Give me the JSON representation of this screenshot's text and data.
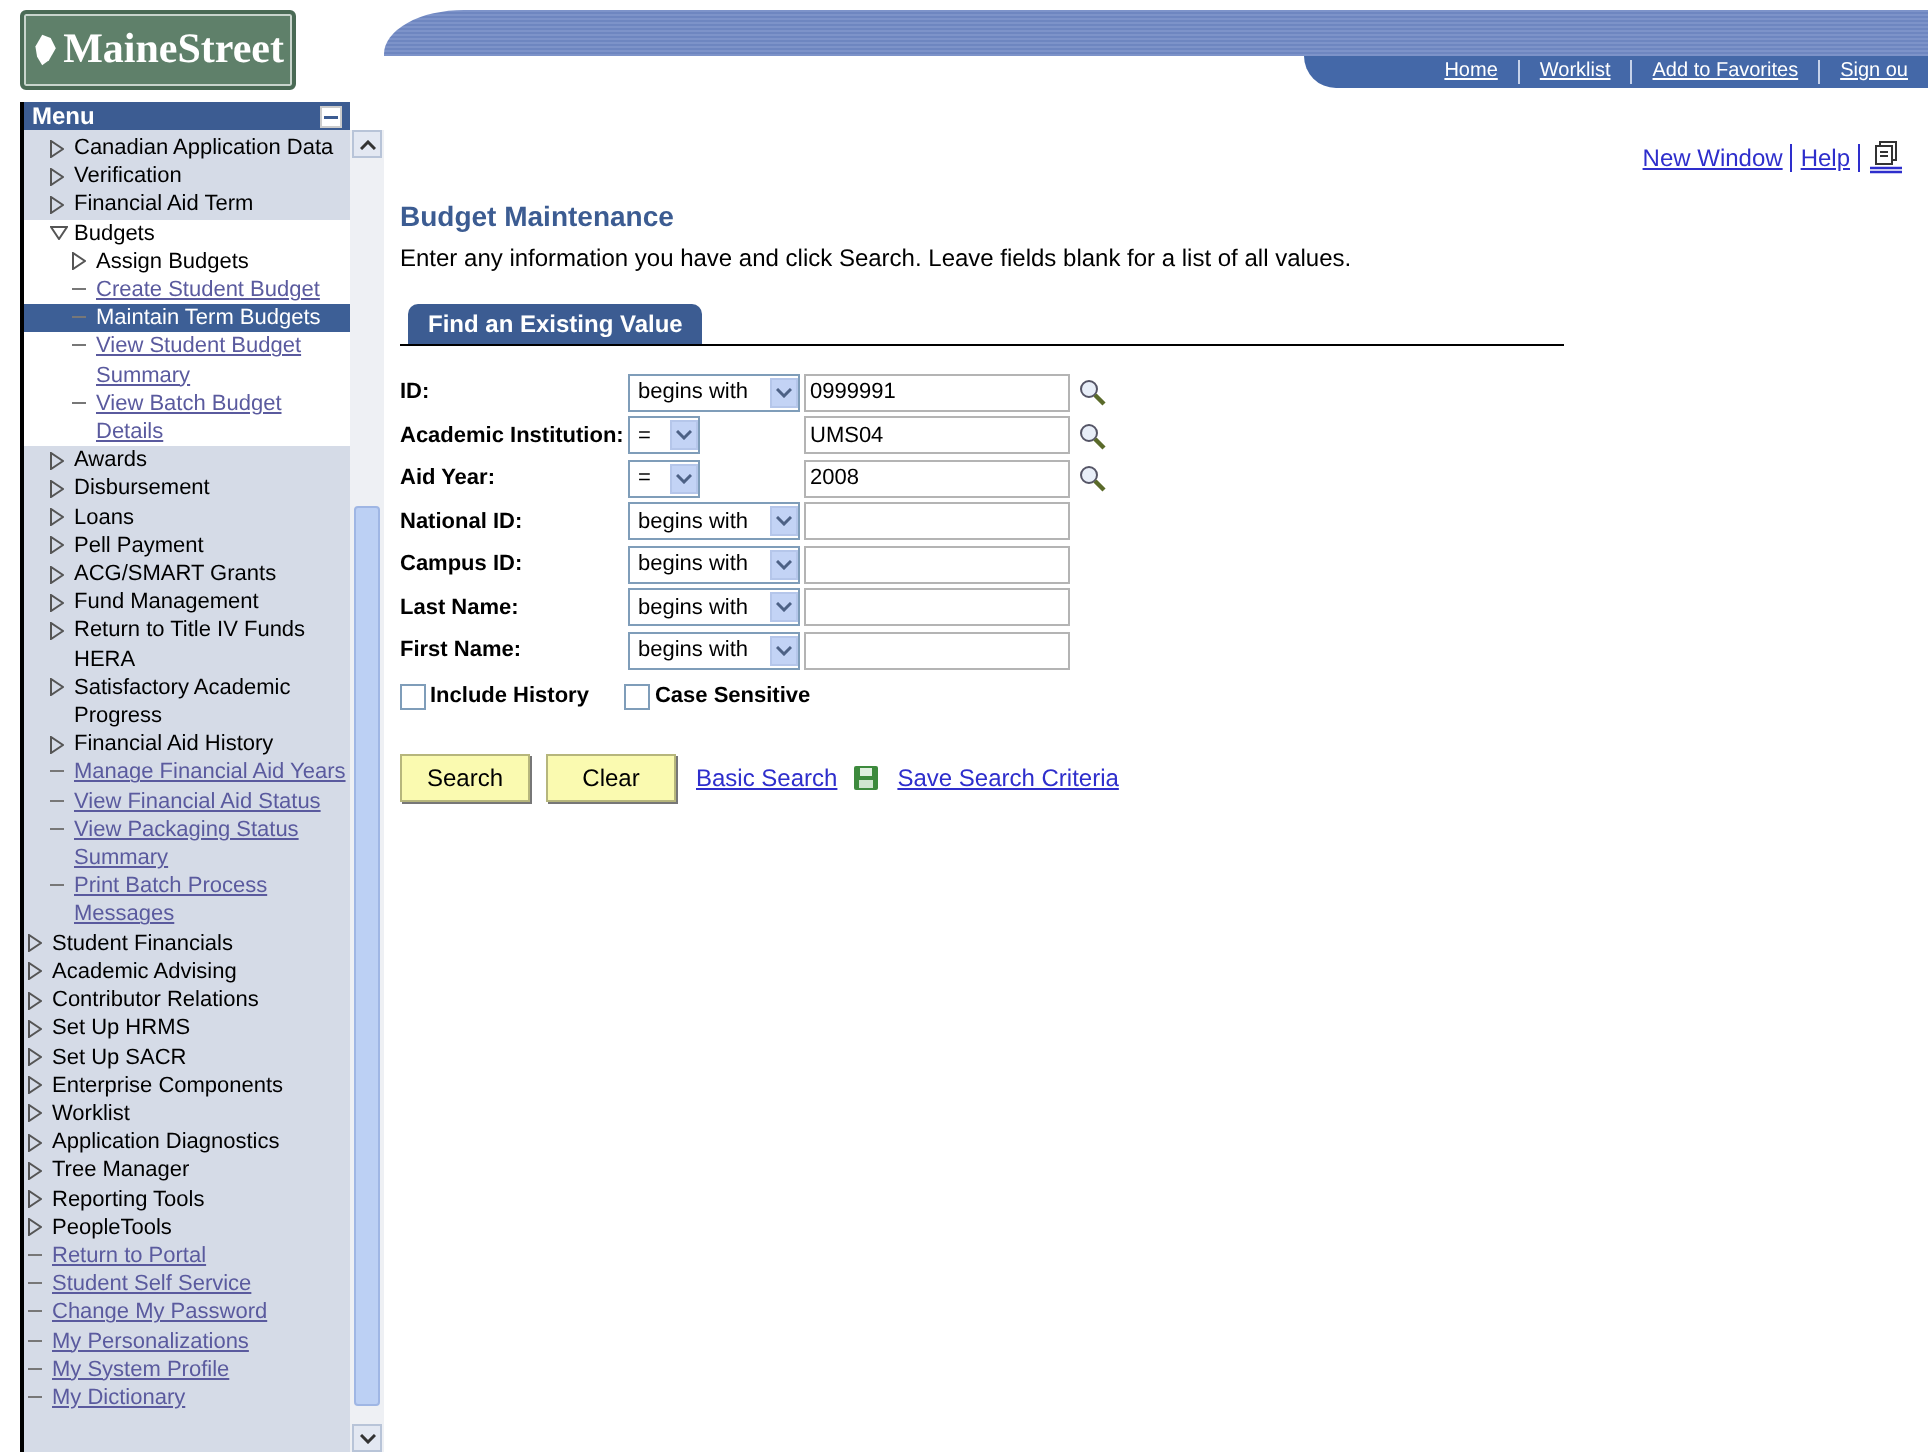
{
  "logo": {
    "text": "MaineStreet"
  },
  "top_nav": [
    "Home",
    "Worklist",
    "Add to Favorites",
    "Sign ou"
  ],
  "menu": {
    "title": "Menu",
    "items": [
      {
        "kind": "hidden",
        "children": [
          {
            "kind": "folder",
            "label": "Canadian Application Data",
            "expanded": false
          },
          {
            "kind": "folder",
            "label": "Verification",
            "expanded": false
          },
          {
            "kind": "folder",
            "label": "Financial Aid Term",
            "expanded": false
          },
          {
            "kind": "folder",
            "label": "Budgets",
            "expanded": true,
            "children": [
              {
                "kind": "folder",
                "label": "Assign Budgets",
                "expanded": false
              },
              {
                "kind": "link",
                "label": "Create Student Budget",
                "selected": false
              },
              {
                "kind": "link",
                "label": "Maintain Term Budgets",
                "selected": true
              },
              {
                "kind": "link",
                "label": "View Student Budget Summary",
                "selected": false
              },
              {
                "kind": "link",
                "label": "View Batch Budget Details",
                "selected": false
              }
            ]
          },
          {
            "kind": "folder",
            "label": "Awards",
            "expanded": false
          },
          {
            "kind": "folder",
            "label": "Disbursement",
            "expanded": false
          },
          {
            "kind": "folder",
            "label": "Loans",
            "expanded": false
          },
          {
            "kind": "folder",
            "label": "Pell Payment",
            "expanded": false
          },
          {
            "kind": "folder",
            "label": "ACG/SMART Grants",
            "expanded": false
          },
          {
            "kind": "folder",
            "label": "Fund Management",
            "expanded": false
          },
          {
            "kind": "folder",
            "label": "Return to Title IV Funds HERA",
            "expanded": false
          },
          {
            "kind": "folder",
            "label": "Satisfactory Academic Progress",
            "expanded": false
          },
          {
            "kind": "folder",
            "label": "Financial Aid History",
            "expanded": false
          },
          {
            "kind": "link",
            "label": "Manage Financial Aid Years",
            "selected": false
          },
          {
            "kind": "link",
            "label": "View Financial Aid Status",
            "selected": false
          },
          {
            "kind": "link",
            "label": "View Packaging Status Summary",
            "selected": false
          },
          {
            "kind": "link",
            "label": "Print Batch Process Messages",
            "selected": false
          }
        ]
      },
      {
        "kind": "folder",
        "label": "Student Financials",
        "expanded": false
      },
      {
        "kind": "folder",
        "label": "Academic Advising",
        "expanded": false
      },
      {
        "kind": "folder",
        "label": "Contributor Relations",
        "expanded": false
      },
      {
        "kind": "folder",
        "label": "Set Up HRMS",
        "expanded": false
      },
      {
        "kind": "folder",
        "label": "Set Up SACR",
        "expanded": false
      },
      {
        "kind": "folder",
        "label": "Enterprise Components",
        "expanded": false
      },
      {
        "kind": "folder",
        "label": "Worklist",
        "expanded": false
      },
      {
        "kind": "folder",
        "label": "Application Diagnostics",
        "expanded": false
      },
      {
        "kind": "folder",
        "label": "Tree Manager",
        "expanded": false
      },
      {
        "kind": "folder",
        "label": "Reporting Tools",
        "expanded": false
      },
      {
        "kind": "folder",
        "label": "PeopleTools",
        "expanded": false
      },
      {
        "kind": "link",
        "label": "Return to Portal",
        "selected": false
      },
      {
        "kind": "link",
        "label": "Student Self Service",
        "selected": false
      },
      {
        "kind": "link",
        "label": "Change My Password",
        "selected": false
      },
      {
        "kind": "link",
        "label": "My Personalizations",
        "selected": false
      },
      {
        "kind": "link",
        "label": "My System Profile",
        "selected": false
      },
      {
        "kind": "link",
        "label": "My Dictionary",
        "selected": false
      }
    ]
  },
  "page_links": [
    "New Window",
    "Help"
  ],
  "page": {
    "title": "Budget Maintenance",
    "instructions": "Enter any information you have and click Search. Leave fields blank for a list of all values.",
    "tabs": [
      {
        "label": "Find an Existing Value",
        "selected": true
      }
    ],
    "fields": [
      {
        "label": "ID:",
        "operator": "begins with",
        "value": "0999991",
        "lookup": true
      },
      {
        "label": "Academic Institution:",
        "operator": "=",
        "value": "UMS04",
        "lookup": true
      },
      {
        "label": "Aid Year:",
        "operator": "=",
        "value": "2008",
        "lookup": true
      },
      {
        "label": "National ID:",
        "operator": "begins with",
        "lookup": false
      },
      {
        "label": "Campus ID:",
        "operator": "begins with",
        "lookup": false
      },
      {
        "label": "Last Name:",
        "operator": "begins with",
        "lookup": false
      },
      {
        "label": "First Name:",
        "operator": "begins with",
        "lookup": false
      }
    ],
    "checkboxes": [
      {
        "label": "Include History",
        "checked": false
      },
      {
        "label": "Case Sensitive",
        "checked": false
      }
    ],
    "buttons": [
      "Search",
      "Clear"
    ],
    "links": [
      {
        "label": "Basic Search",
        "icon": false
      },
      {
        "label": "Save Search Criteria",
        "icon": true
      }
    ]
  }
}
